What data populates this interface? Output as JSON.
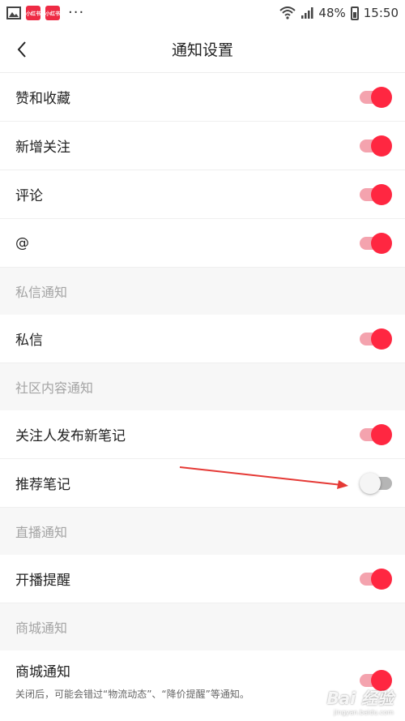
{
  "status_bar": {
    "app_badge_1": "小红书",
    "app_badge_2": "小红书",
    "more": "···",
    "battery_percent": "48%",
    "time": "15:50"
  },
  "header": {
    "title": "通知设置"
  },
  "settings": {
    "likes_favorites": {
      "label": "赞和收藏",
      "enabled": true
    },
    "new_followers": {
      "label": "新增关注",
      "enabled": true
    },
    "comments": {
      "label": "评论",
      "enabled": true
    },
    "mentions": {
      "label": "@",
      "enabled": true
    },
    "dm_section": "私信通知",
    "dm": {
      "label": "私信",
      "enabled": true
    },
    "community_section": "社区内容通知",
    "following_notes": {
      "label": "关注人发布新笔记",
      "enabled": true
    },
    "recommended_notes": {
      "label": "推荐笔记",
      "enabled": false
    },
    "live_section": "直播通知",
    "live_start": {
      "label": "开播提醒",
      "enabled": true
    },
    "mall_section": "商城通知",
    "mall": {
      "label": "商城通知",
      "hint": "关闭后，可能会错过“物流动态”、“降价提醒”等通知。",
      "enabled": true
    }
  },
  "watermark": {
    "main": "Bai 经验",
    "sub": "jingyan.baidu.com"
  },
  "colors": {
    "accent": "#ff2741",
    "accent_track": "#f4a3ae",
    "annotation_arrow": "#e53935"
  }
}
